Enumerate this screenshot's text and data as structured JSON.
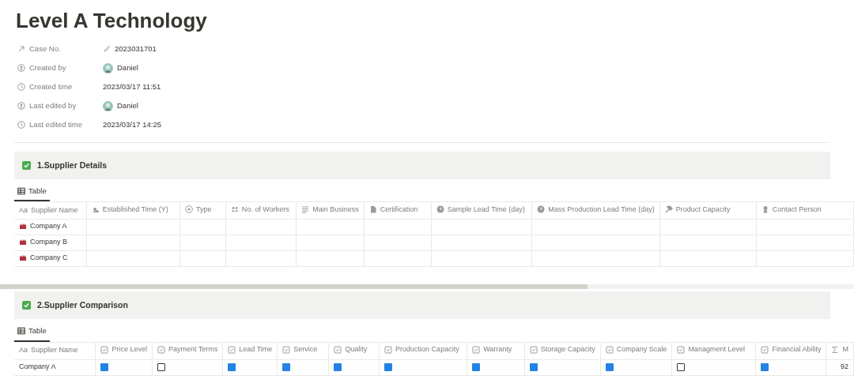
{
  "title": "Level A Technology",
  "properties": [
    {
      "label": "Case No.",
      "value": "2023031701",
      "kind": "text"
    },
    {
      "label": "Created by",
      "value": "Daniel",
      "kind": "person"
    },
    {
      "label": "Created time",
      "value": "2023/03/17 11:51",
      "kind": "time"
    },
    {
      "label": "Last edited by",
      "value": "Daniel",
      "kind": "person"
    },
    {
      "label": "Last edited time",
      "value": "2023/03/17 14:25",
      "kind": "time"
    }
  ],
  "sections": [
    {
      "heading": "1.Supplier Details",
      "checked": true,
      "view_tab": "Table",
      "title_icon": "Aa",
      "columns": [
        "Supplier Name",
        "Established Time   (Y)",
        "Type",
        "No. of Workers",
        "Main Business",
        "Certification",
        "Sample Lead Time (day)",
        "Mass Production Lead Time (day)",
        "Product Capacity",
        "Contact Person"
      ],
      "rows": [
        {
          "name": "Company A"
        },
        {
          "name": "Company B"
        },
        {
          "name": "Company C"
        }
      ]
    },
    {
      "heading": "2.Supplier Comparison",
      "checked": true,
      "view_tab": "Table",
      "title_icon": "Aa",
      "columns": [
        "Supplier Name",
        "Price Level",
        "Payment Terms",
        "Lead Time",
        "Service",
        "Quality",
        "Production Capacity",
        "Warranty",
        "Storage Capacity",
        "Company Scale",
        "Managment Level",
        "Financial Ability",
        "M"
      ],
      "rows": [
        {
          "name": "Company A",
          "checks": [
            true,
            false,
            true,
            true,
            true,
            true,
            true,
            true,
            true,
            false,
            true
          ],
          "total": "92"
        }
      ]
    }
  ]
}
